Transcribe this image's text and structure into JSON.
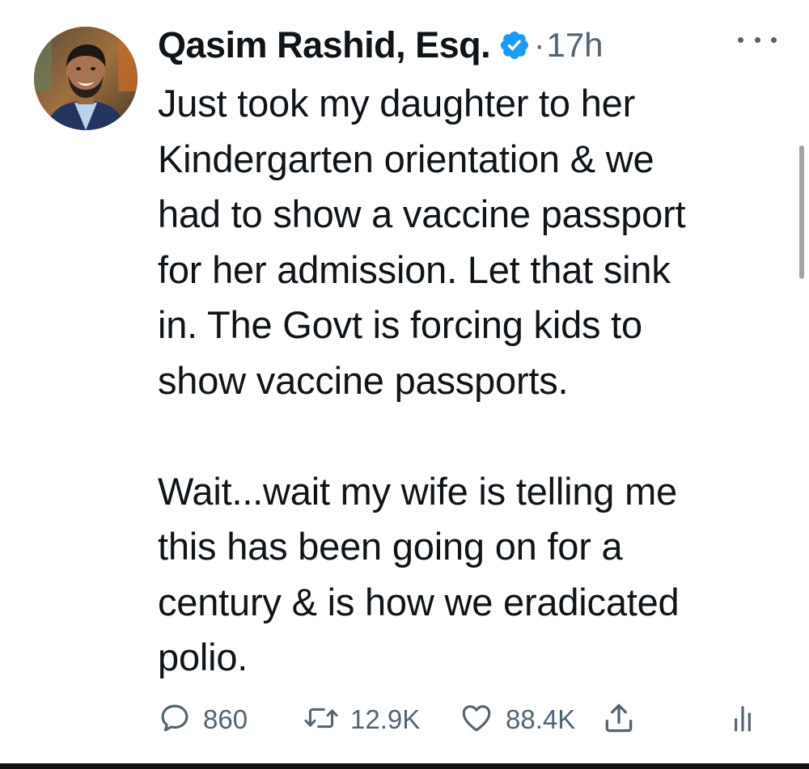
{
  "tweet": {
    "author": {
      "display_name": "Qasim Rashid, Esq.",
      "verified": true,
      "verified_icon": "verified-badge-icon",
      "separator": "·",
      "timestamp": "17h"
    },
    "more_icon": "more-options-icon",
    "text_lines": [
      "Just took my daughter to her",
      "Kindergarten orientation & we",
      "had to show a vaccine passport",
      "for her admission. Let that sink",
      "in. The Govt is forcing kids to",
      "show vaccine passports.",
      "",
      "Wait...wait my wife is telling me",
      "this has been going on for a",
      "century & is how we eradicated",
      "polio."
    ],
    "actions": {
      "reply": {
        "icon": "reply-icon",
        "count": "860"
      },
      "retweet": {
        "icon": "retweet-icon",
        "count": "12.9K"
      },
      "like": {
        "icon": "heart-icon",
        "count": "88.4K"
      },
      "share": {
        "icon": "share-icon"
      },
      "analytics": {
        "icon": "analytics-icon"
      }
    },
    "colors": {
      "text": "#0f1419",
      "secondary": "#536471",
      "verified": "#1d9bf0"
    }
  }
}
